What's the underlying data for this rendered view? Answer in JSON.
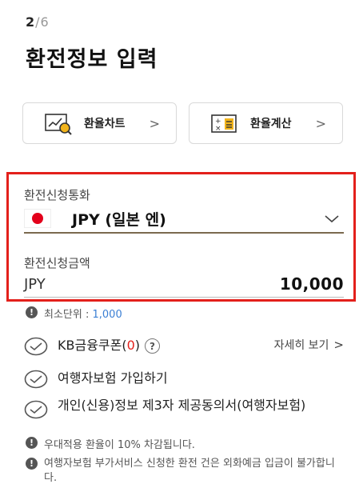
{
  "step": {
    "current": "2",
    "separator": "/",
    "total": "6"
  },
  "title": "환전정보 입력",
  "quick_links": [
    {
      "label": "환율차트",
      "icon": "chart-magnifier-icon"
    },
    {
      "label": "환율계산",
      "icon": "calculator-icon"
    }
  ],
  "currency": {
    "label": "환전신청통화",
    "value": "JPY (일본 엔)",
    "flag": "japan-flag-icon"
  },
  "amount": {
    "label": "환전신청금액",
    "currency": "JPY",
    "value": "10,000"
  },
  "min_unit": {
    "label": "최소단위 : ",
    "value": "1,000"
  },
  "options": {
    "coupon": {
      "label_prefix": "KB금융쿠폰(",
      "count": "0",
      "label_suffix": ")",
      "detail": "자세히 보기"
    },
    "insurance": {
      "label": "여행자보험 가입하기"
    },
    "privacy": {
      "label": "개인(신용)정보 제3자 제공동의서(여행자보험)"
    }
  },
  "notices": [
    "우대적용 환율이 10% 차감됩니다.",
    "여행자보험 부가서비스 신청한 환전 건은 외화예금 입금이 불가합니다."
  ],
  "colors": {
    "highlight": "#e3201b",
    "link_value": "#3b7fd4",
    "flag_red": "#e3001b",
    "field_underline": "#7b6a4f"
  }
}
